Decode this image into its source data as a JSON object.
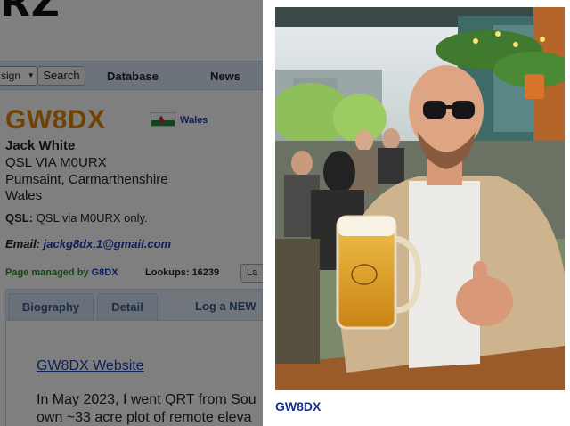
{
  "header": {
    "logo_text": "RZ"
  },
  "nav": {
    "select_value": "sign",
    "search_label": "Search",
    "links": [
      "Database",
      "News"
    ]
  },
  "profile": {
    "callsign": "GW8DX",
    "country": "Wales",
    "name": "Jack White",
    "address_lines": [
      "QSL VIA M0URX",
      "Pumsaint, Carmarthenshire",
      "Wales"
    ],
    "qsl_label": "QSL:",
    "qsl_text": "QSL via M0URX only.",
    "email_label": "Email:",
    "email": "jackg8dx.1@gmail.com",
    "managed_label": "Page managed by",
    "manager": "G8DX",
    "lookups_label": "Lookups:",
    "lookups": "16239",
    "lang_button": "La"
  },
  "tabs": {
    "biography": "Biography",
    "detail": "Detail",
    "log": "Log a NEW"
  },
  "content": {
    "website_link": "GW8DX Website",
    "bio_lines": [
      "In May 2023, I went QRT from Sou",
      "own ~33 acre plot of remote eleva"
    ]
  },
  "lightbox": {
    "caption": "GW8DX",
    "image_description_icon": "photo-of-operator"
  },
  "colors": {
    "callsign": "#e0860a",
    "link": "#1a3fb0",
    "managed": "#2a8a2a",
    "nav_bg": "#dbe7f6"
  }
}
